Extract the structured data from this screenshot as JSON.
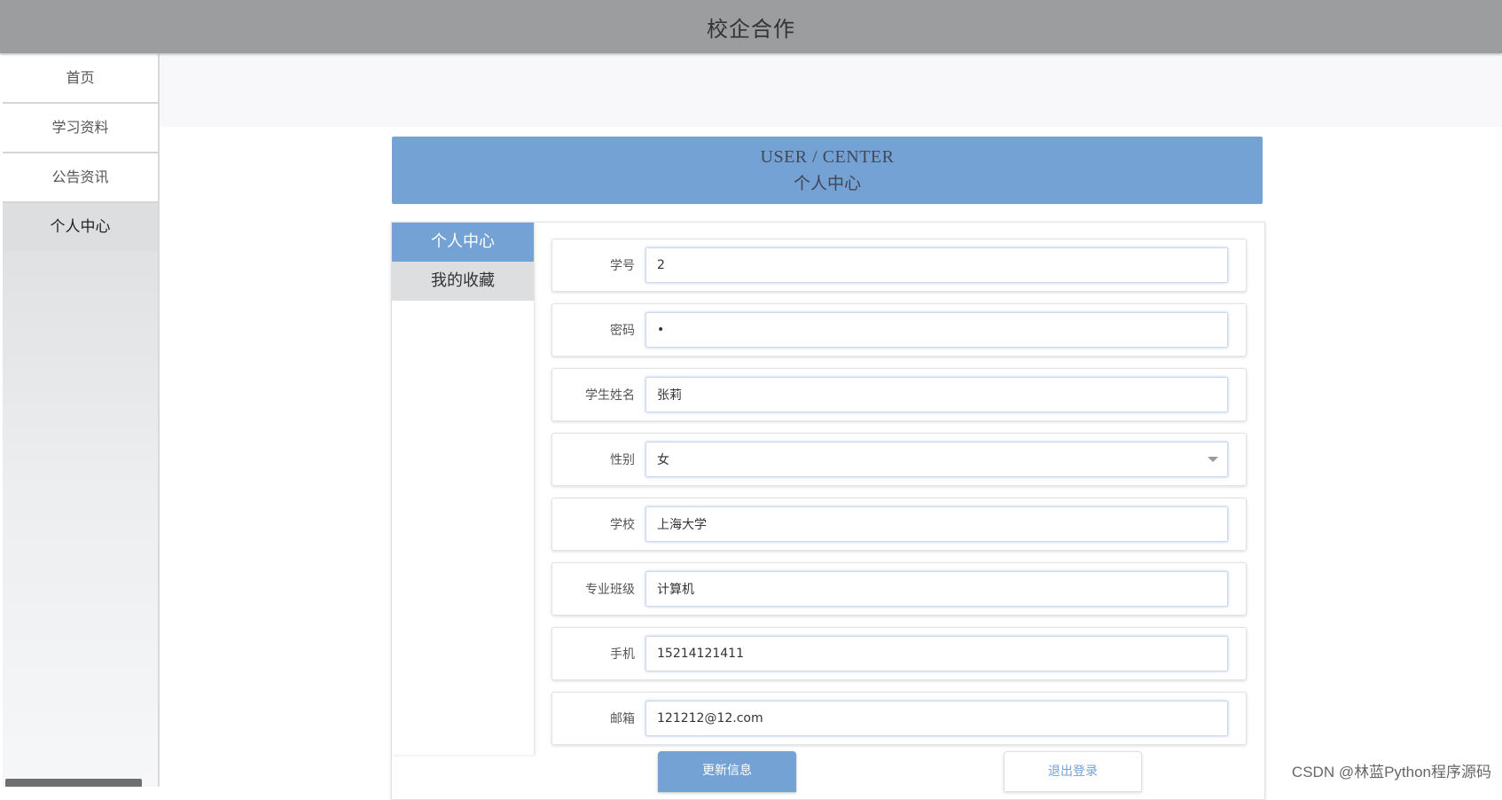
{
  "header": {
    "title": "校企合作"
  },
  "sidebar": {
    "items": [
      {
        "label": "首页"
      },
      {
        "label": "学习资料"
      },
      {
        "label": "公告资讯"
      },
      {
        "label": "个人中心"
      }
    ],
    "active": "个人中心"
  },
  "banner": {
    "en": "USER / CENTER",
    "cn": "个人中心"
  },
  "tabs": [
    {
      "label": "个人中心"
    },
    {
      "label": "我的收藏"
    }
  ],
  "form": {
    "fields": [
      {
        "label": "学号",
        "value": "2"
      },
      {
        "label": "密码",
        "value": "•"
      },
      {
        "label": "学生姓名",
        "value": "张莉"
      },
      {
        "label": "性别",
        "value": "女"
      },
      {
        "label": "学校",
        "value": "上海大学"
      },
      {
        "label": "专业班级",
        "value": "计算机"
      },
      {
        "label": "手机",
        "value": "15214121411"
      },
      {
        "label": "邮箱",
        "value": "121212@12.com"
      }
    ]
  },
  "buttons": {
    "update": "更新信息",
    "logout": "退出登录"
  },
  "watermark": "CSDN @林蓝Python程序源码",
  "colors": {
    "accent": "#74a2d4",
    "header_bg": "#9b9d9e"
  },
  "icons": {
    "select_caret": "chevron-down-icon"
  }
}
